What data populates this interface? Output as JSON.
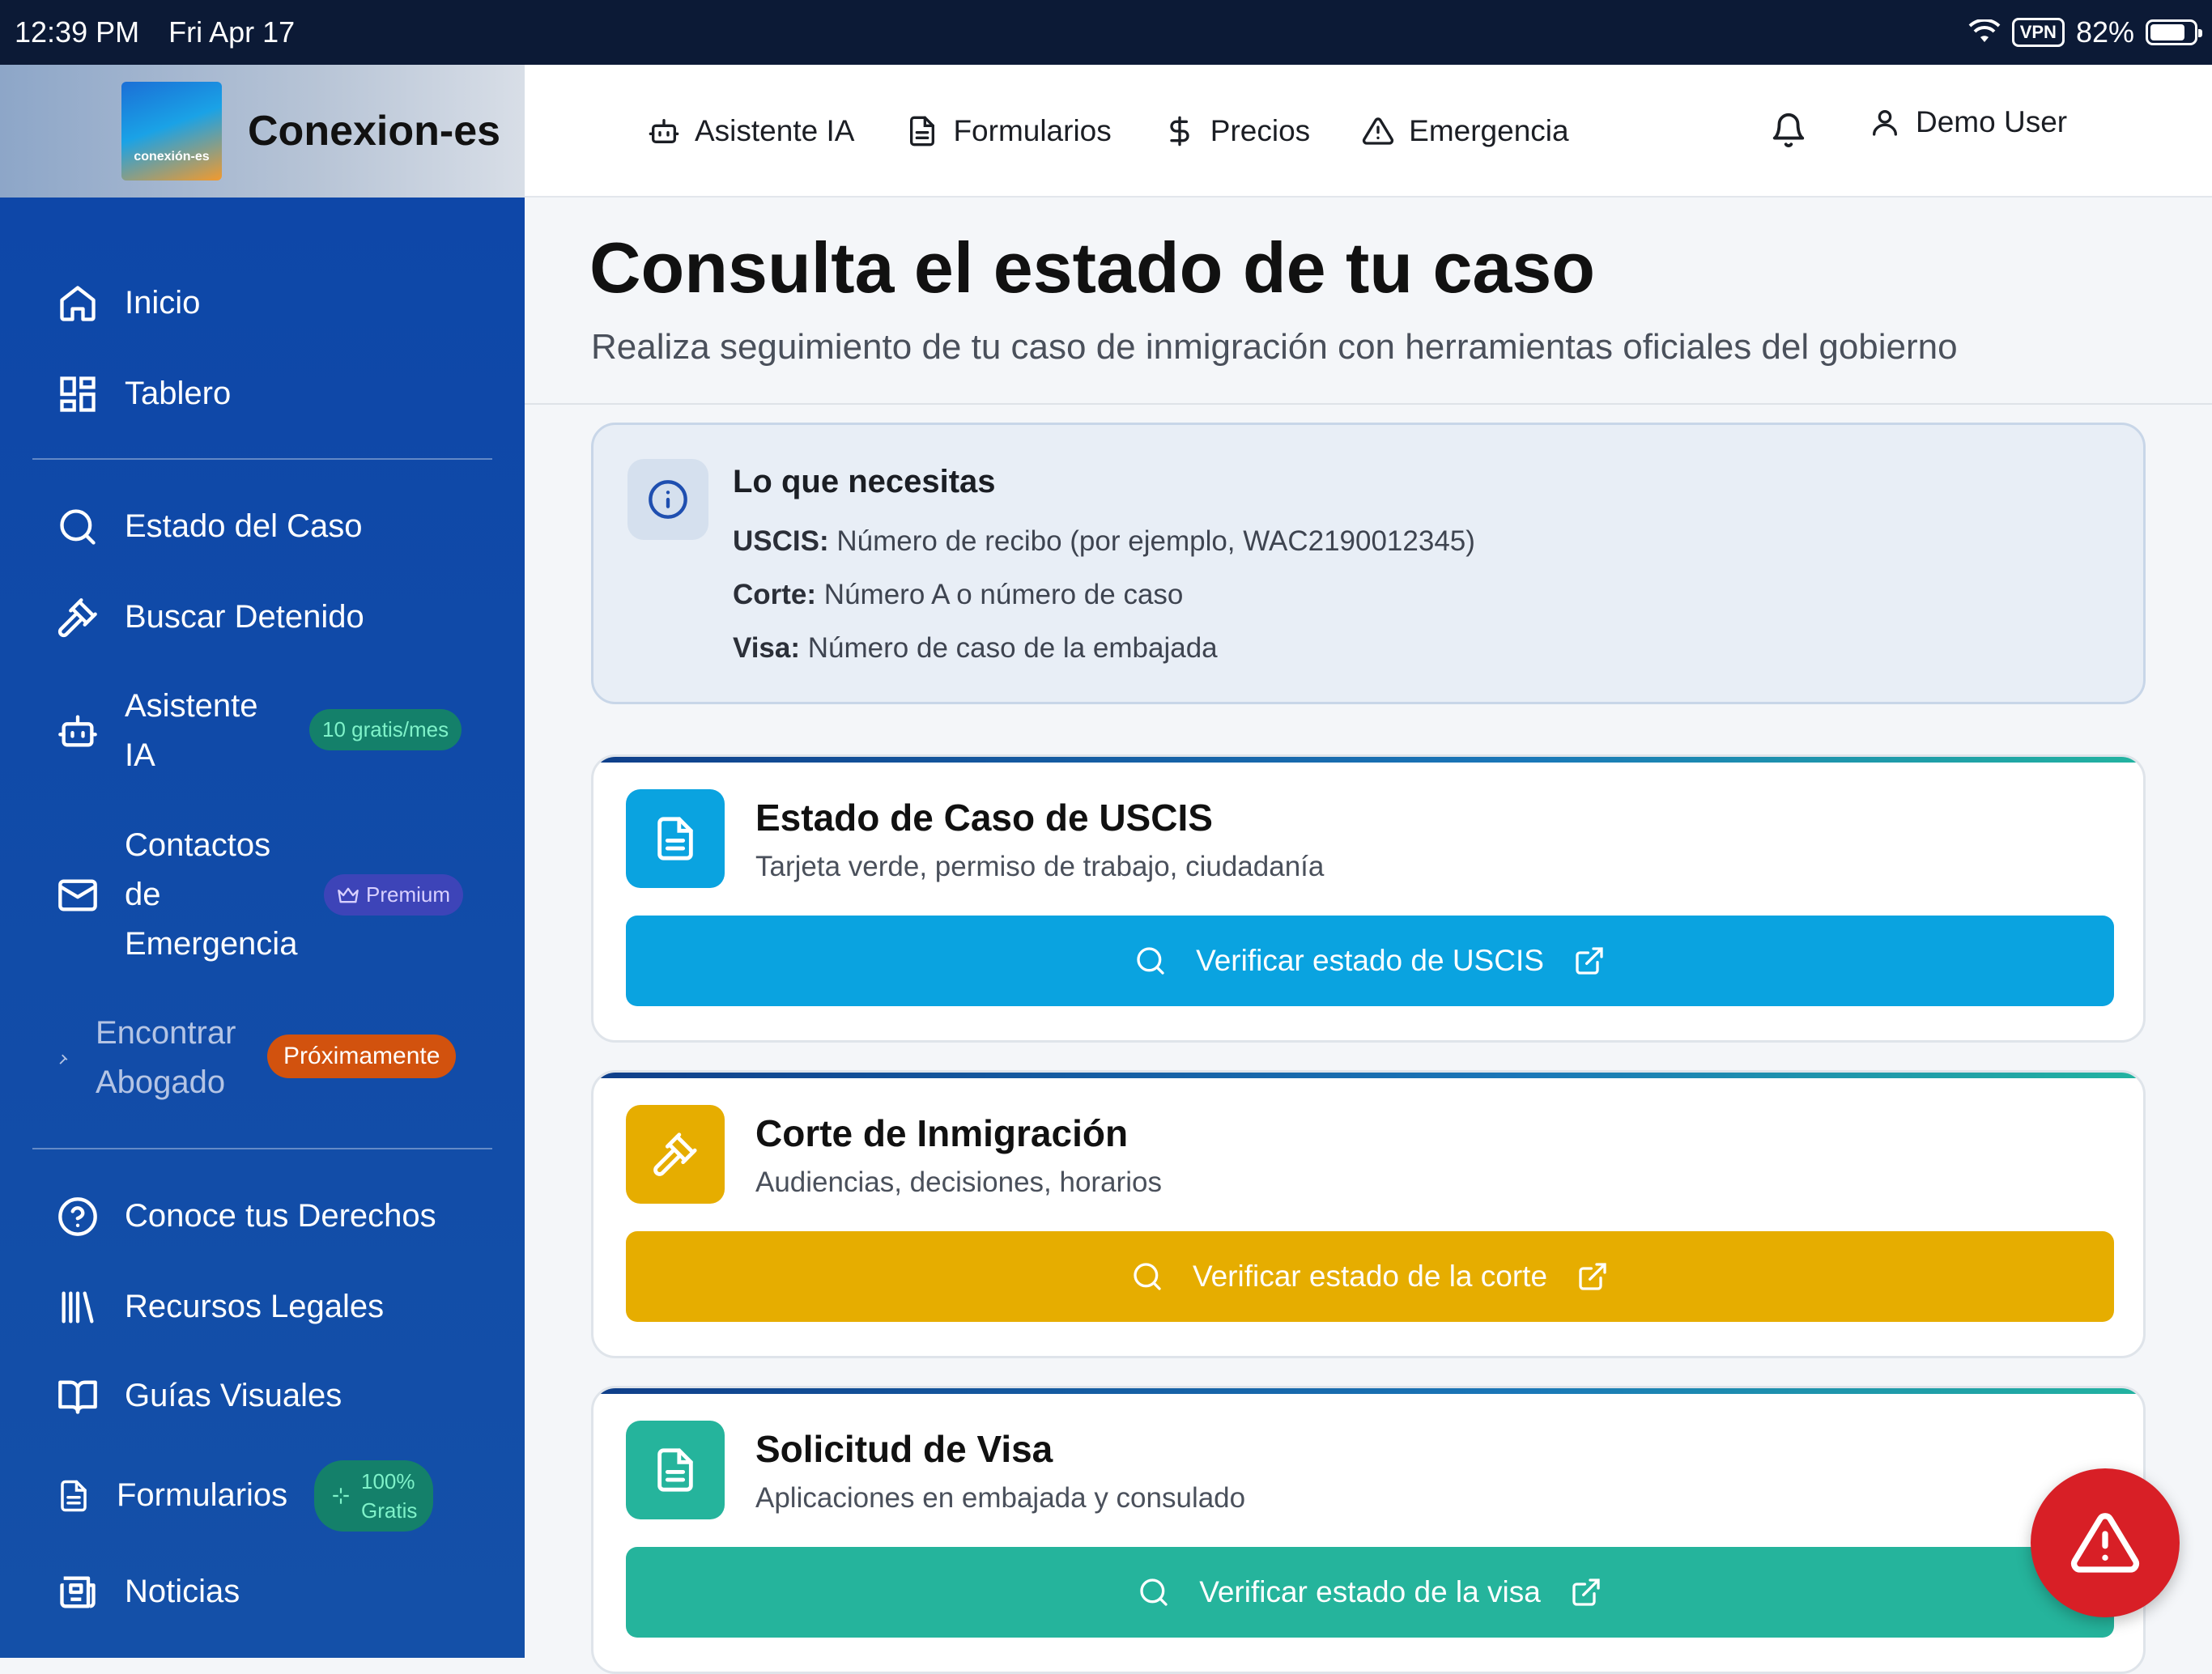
{
  "status_bar": {
    "time": "12:39 PM",
    "date": "Fri Apr 17",
    "vpn": "VPN",
    "battery": "82%"
  },
  "brand": {
    "name": "Conexion-es",
    "logo_text": "conexión-es"
  },
  "top_nav": {
    "items": [
      {
        "label": "Asistente IA",
        "icon": "robot-icon"
      },
      {
        "label": "Formularios",
        "icon": "document-icon"
      },
      {
        "label": "Precios",
        "icon": "dollar-icon"
      },
      {
        "label": "Emergencia",
        "icon": "warning-icon"
      }
    ],
    "user": "Demo User"
  },
  "sidebar": {
    "inicio": "Inicio",
    "tablero": "Tablero",
    "estado": "Estado del Caso",
    "detenido": "Buscar Detenido",
    "asistente": "Asistente IA",
    "asistente_badge": "10 gratis/mes",
    "contactos": "Contactos de Emergencia",
    "contactos_badge": "Premium",
    "abogado": "Encontrar Abogado",
    "abogado_badge": "Próximamente",
    "derechos": "Conoce tus Derechos",
    "recursos": "Recursos Legales",
    "guias": "Guías Visuales",
    "formularios": "Formularios",
    "formularios_badge_1": "100%",
    "formularios_badge_2": "Gratis",
    "noticias": "Noticias"
  },
  "page": {
    "title": "Consulta el estado de tu caso",
    "subtitle": "Realiza seguimiento de tu caso de inmigración con herramientas oficiales del gobierno"
  },
  "info": {
    "title": "Lo que necesitas",
    "lines": [
      {
        "label": "USCIS:",
        "text": "Número de recibo (por ejemplo, WAC2190012345)"
      },
      {
        "label": "Corte:",
        "text": "Número A o número de caso"
      },
      {
        "label": "Visa:",
        "text": "Número de caso de la embajada"
      }
    ]
  },
  "cards": [
    {
      "title": "Estado de Caso de USCIS",
      "subtitle": "Tarjeta verde, permiso de trabajo, ciudadanía",
      "button": "Verificar estado de USCIS",
      "color": "#0aa3e0"
    },
    {
      "title": "Corte de Inmigración",
      "subtitle": "Audiencias, decisiones, horarios",
      "button": "Verificar estado de la corte",
      "color": "#e6ad00"
    },
    {
      "title": "Solicitud de Visa",
      "subtitle": "Aplicaciones en embajada y consulado",
      "button": "Verificar estado de la visa",
      "color": "#25b49c"
    }
  ]
}
